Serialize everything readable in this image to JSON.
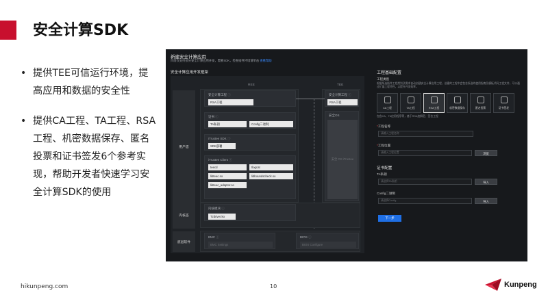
{
  "slide": {
    "title": "安全计算SDK",
    "bullets": [
      "提供TEE可信运行环境，提高应用和数据的安全性",
      "提供CA工程、TA工程、RSA工程、机密数据保存、匿名投票和证书签发6个参考实现，帮助开发者快速学习安全计算SDK的使用"
    ],
    "footer_url": "hikunpeng.com",
    "page_number": "10",
    "logo_text": "Kunpeng",
    "accent_color": "#c8102e"
  },
  "screenshot": {
    "header": {
      "title": "新建安全计算应用",
      "subtitle": "目前仅支持部分安全计算应用开发，需要SDK，检查插件环境请单击",
      "subtitle_link": "查看帮助"
    },
    "arch": {
      "title": "安全计算应用开发框架",
      "ree_label": "REE",
      "tee_label": "TEE",
      "user_mode": "用户态",
      "kernel_mode": "内核态",
      "firmware": "底层软件",
      "ca_project": {
        "label": "安全计算工程",
        "value": "RSA工程"
      },
      "certificate": {
        "label": "证书",
        "ta_cert": "TA私钥",
        "config_cert": "Config二进制"
      },
      "itrustee_sdk": {
        "label": "iTrustee SDK",
        "value": "SDK部署"
      },
      "itrustee_client": {
        "label": "iTrustee Client",
        "items": [
          "teecd",
          "tlogcat",
          "libteec.so",
          "libboundscheck.so",
          "libteec_adaptor.so"
        ]
      },
      "kernel_module": {
        "label": "内核模块",
        "value": "Tzdriver.ko"
      },
      "bmc": {
        "label": "BMC",
        "placeholder": "BMC Settings"
      },
      "ta_project": {
        "label": "安全计算工程",
        "value": "RSA工程"
      },
      "tee_os": {
        "label": "安全OS",
        "fill_text": "安全 OS iTrustee"
      },
      "bios": {
        "label": "BIOS",
        "placeholder": "BIOS Configure"
      }
    },
    "form": {
      "title": "工程基础配置",
      "project_type_label": "工程类别",
      "project_type_desc": "根据所选插件工程类别及需求自动创建安全计算应用工程，创建的工程中会包含所选的使用指南及模板代码工程文件，可以通过扩展工程特性，以提升开发效率。",
      "project_types": [
        "CA工程",
        "TA工程",
        "RSA工程",
        "机密数据保存",
        "匿名投票",
        "证书签发"
      ],
      "selected_type": "RSA工程",
      "type_note": "包含CA、TA应用程序等，基于RSA加解密、签名工程",
      "project_name_label": "工程名称",
      "project_name_placeholder": "请输入工程名称",
      "project_location_label": "工程位置",
      "project_location_placeholder": "请输入工程位置",
      "browse_button": "浏览",
      "cert_section_title": "证书配置",
      "ta_key_label": "TA私钥",
      "ta_key_placeholder": "请选择TA私钥",
      "import_button": "导入",
      "config_label": "Config二进制",
      "config_placeholder": "请选择Config",
      "import_button_2": "导入",
      "next_button": "下一步"
    }
  }
}
